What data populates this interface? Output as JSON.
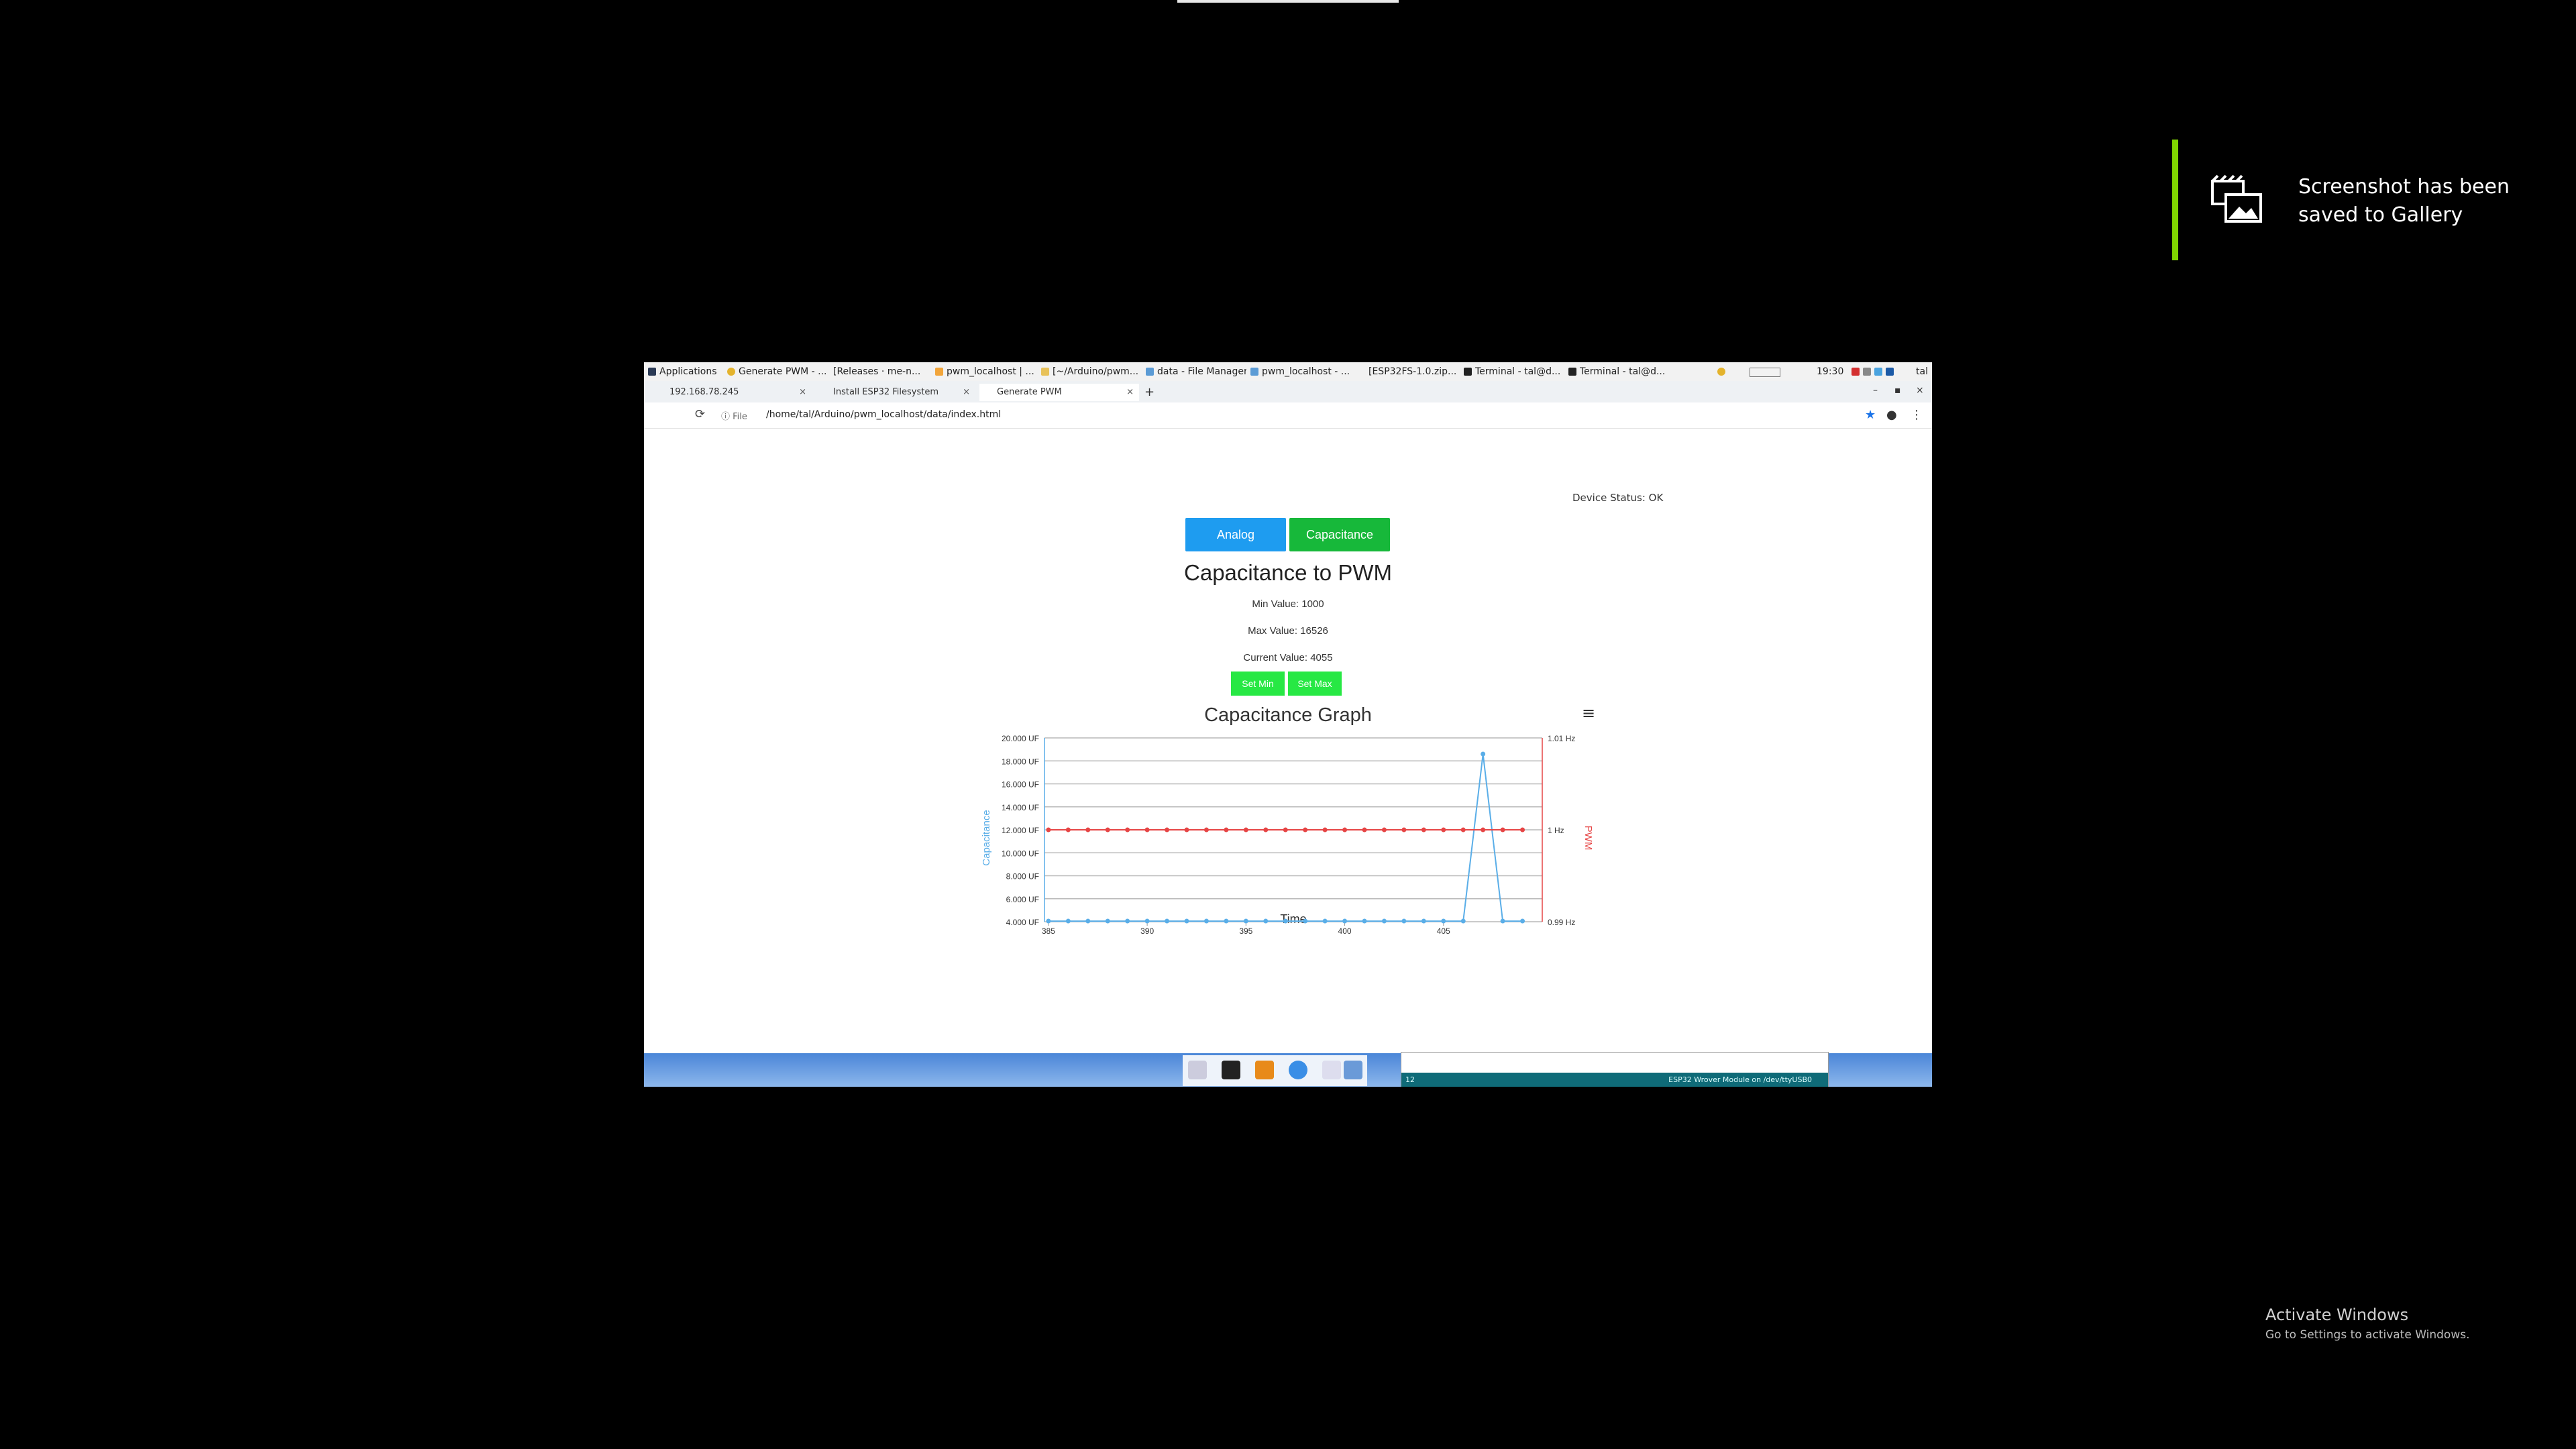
{
  "toast": {
    "text": "Screenshot has been saved to Gallery"
  },
  "activate": {
    "title": "Activate Windows",
    "subtitle": "Go to Settings to activate Windows."
  },
  "panel": {
    "items": [
      "Applications",
      "Generate PWM - ...",
      "[Releases · me-n...",
      "pwm_localhost | ...",
      "[~/Arduino/pwm...",
      "data - File Manager",
      "pwm_localhost - ...",
      "[ESP32FS-1.0.zip...",
      "Terminal - tal@d...",
      "Terminal - tal@d..."
    ],
    "clock": "19:30",
    "user": "tal"
  },
  "tabs": [
    {
      "label": "192.168.78.245"
    },
    {
      "label": "Install ESP32 Filesystem"
    },
    {
      "label": "Generate PWM"
    }
  ],
  "new_tab": "+",
  "address": {
    "file_label": "File",
    "url": "/home/tal/Arduino/pwm_localhost/data/index.html"
  },
  "page": {
    "device_status": "Device Status: OK",
    "analog_label": "Analog",
    "capacitance_label": "Capacitance",
    "title": "Capacitance to PWM",
    "min_value": "Min Value: 1000",
    "max_value": "Max Value: 16526",
    "current_value": "Current Value: 4055",
    "set_min": "Set Min",
    "set_max": "Set Max",
    "menu_glyph": "≡"
  },
  "terminal": {
    "status": "ESP32 Wrover Module on /dev/ttyUSB0",
    "line": "12"
  },
  "colors": {
    "capacitance": "#5aaee8",
    "pwm": "#e64545",
    "analog": "#1e9cf0",
    "capacitance_btn": "#17b83a"
  },
  "chart_data": {
    "type": "line",
    "title": "Capacitance Graph",
    "xlabel": "Time",
    "ylabel_left": "Capacitance",
    "ylabel_right": "PWM",
    "x_ticks": [
      "385",
      "390",
      "395",
      "400",
      "405"
    ],
    "y_left_ticks": [
      "4.000 UF",
      "6.000 UF",
      "8.000 UF",
      "10.000 UF",
      "12.000 UF",
      "14.000 UF",
      "16.000 UF",
      "18.000 UF",
      "20.000 UF"
    ],
    "y_right_ticks": [
      "0.99 Hz",
      "1 Hz",
      "1.01 Hz"
    ],
    "xlim": [
      384.8,
      410
    ],
    "ylim_left": [
      4000,
      20000
    ],
    "ylim_right": [
      0.99,
      1.01
    ],
    "series": [
      {
        "name": "Capacitance",
        "axis": "left",
        "x": [
          385,
          386,
          387,
          388,
          389,
          390,
          391,
          392,
          393,
          394,
          395,
          396,
          397,
          398,
          399,
          400,
          401,
          402,
          403,
          404,
          405,
          406,
          407,
          408,
          409
        ],
        "values": [
          4055,
          4055,
          4055,
          4055,
          4055,
          4055,
          4055,
          4055,
          4055,
          4055,
          4055,
          4055,
          4055,
          4055,
          4055,
          4055,
          4055,
          4055,
          4055,
          4055,
          4055,
          4055,
          18600,
          4055,
          4055
        ]
      },
      {
        "name": "PWM",
        "axis": "right",
        "x": [
          385,
          386,
          387,
          388,
          389,
          390,
          391,
          392,
          393,
          394,
          395,
          396,
          397,
          398,
          399,
          400,
          401,
          402,
          403,
          404,
          405,
          406,
          407,
          408,
          409
        ],
        "values": [
          1,
          1,
          1,
          1,
          1,
          1,
          1,
          1,
          1,
          1,
          1,
          1,
          1,
          1,
          1,
          1,
          1,
          1,
          1,
          1,
          1,
          1,
          1,
          1,
          1
        ]
      }
    ],
    "grid": true
  }
}
